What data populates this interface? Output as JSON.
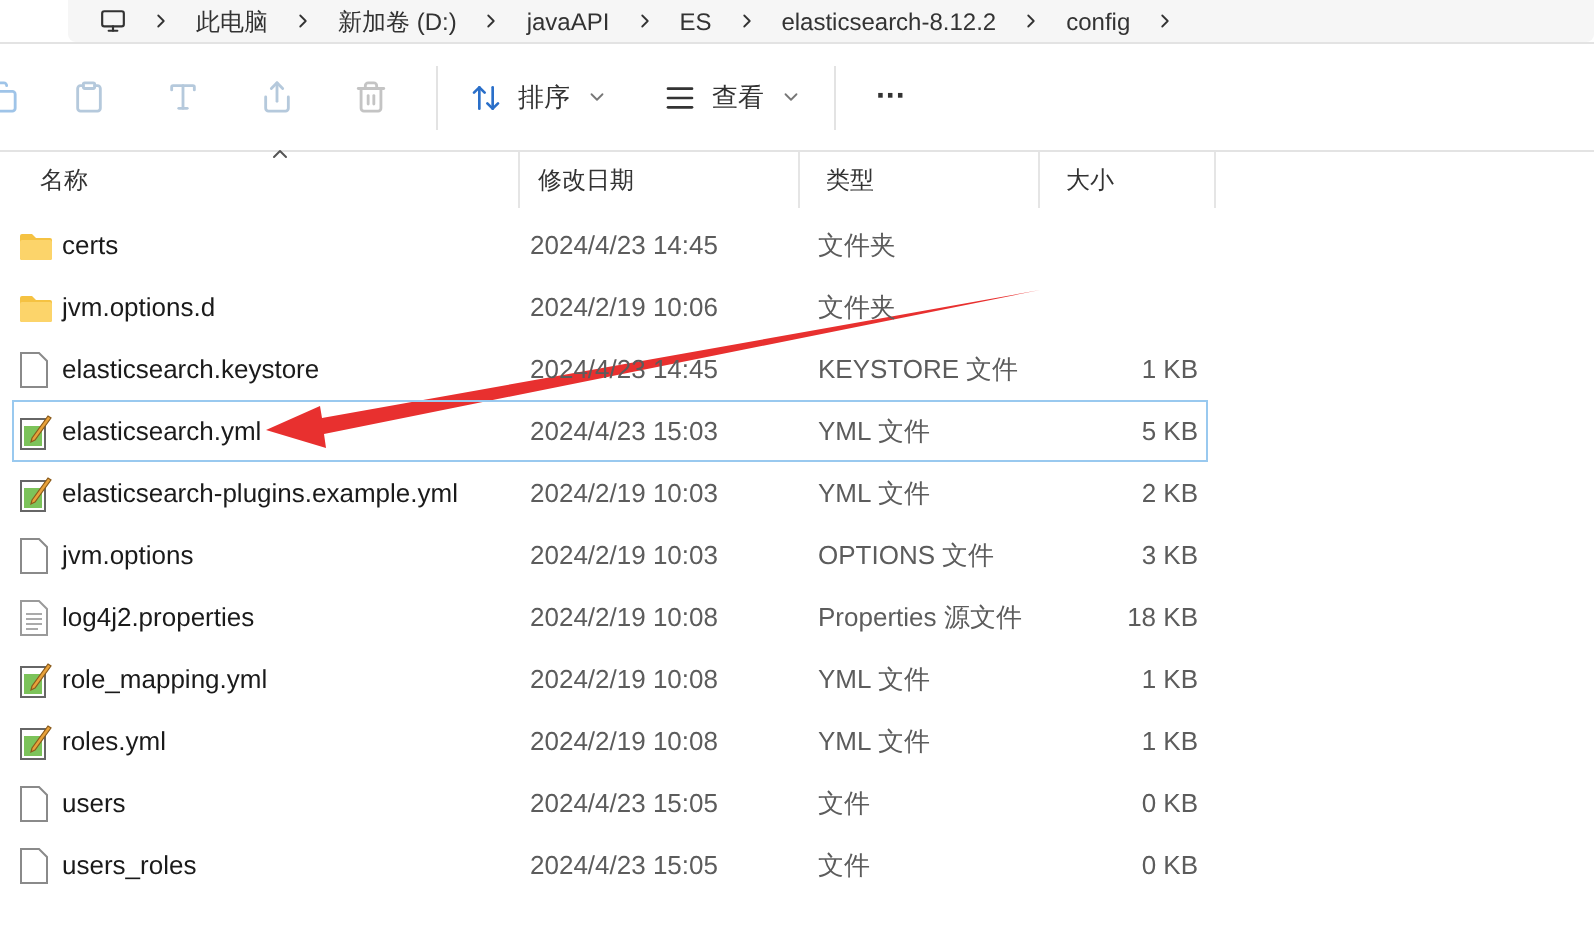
{
  "breadcrumb": [
    "此电脑",
    "新加卷 (D:)",
    "javaAPI",
    "ES",
    "elasticsearch-8.12.2",
    "config"
  ],
  "toolbar": {
    "sort": "排序",
    "view": "查看",
    "more": "···"
  },
  "columns": [
    "名称",
    "修改日期",
    "类型",
    "大小"
  ],
  "files": [
    {
      "name": "certs",
      "date": "2024/4/23 14:45",
      "type": "文件夹",
      "kind": "folder",
      "selected": false
    },
    {
      "name": "jvm.options.d",
      "date": "2024/2/19 10:06",
      "type": "文件夹",
      "kind": "folder",
      "selected": false
    },
    {
      "name": "elasticsearch.keystore",
      "date": "2024/4/23 14:45",
      "type": "KEYSTORE 文件",
      "size": "1 KB",
      "kind": "file",
      "selected": false
    },
    {
      "name": "elasticsearch.yml",
      "date": "2024/4/23 15:03",
      "type": "YML 文件",
      "size": "5 KB",
      "kind": "yml",
      "selected": true
    },
    {
      "name": "elasticsearch-plugins.example.yml",
      "date": "2024/2/19 10:03",
      "type": "YML 文件",
      "size": "2 KB",
      "kind": "yml",
      "selected": false
    },
    {
      "name": "jvm.options",
      "date": "2024/2/19 10:03",
      "type": "OPTIONS 文件",
      "size": "3 KB",
      "kind": "file",
      "selected": false
    },
    {
      "name": "log4j2.properties",
      "date": "2024/2/19 10:08",
      "type": "Properties 源文件",
      "size": "18 KB",
      "kind": "text",
      "selected": false
    },
    {
      "name": "role_mapping.yml",
      "date": "2024/2/19 10:08",
      "type": "YML 文件",
      "size": "1 KB",
      "kind": "yml",
      "selected": false
    },
    {
      "name": "roles.yml",
      "date": "2024/2/19 10:08",
      "type": "YML 文件",
      "size": "1 KB",
      "kind": "yml",
      "selected": false
    },
    {
      "name": "users",
      "date": "2024/4/23 15:05",
      "type": "文件",
      "size": "0 KB",
      "kind": "file",
      "selected": false
    },
    {
      "name": "users_roles",
      "date": "2024/4/23 15:05",
      "type": "文件",
      "size": "0 KB",
      "kind": "file",
      "selected": false
    }
  ]
}
